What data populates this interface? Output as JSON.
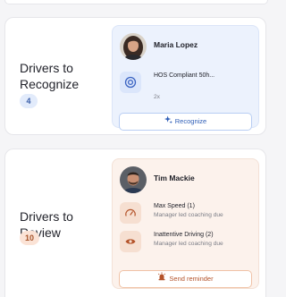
{
  "recognize": {
    "title": "Drivers to Recognize",
    "count": "4",
    "driver": {
      "name": "Maria Lopez"
    },
    "item": {
      "title": "HOS Compliant 50h...",
      "sub": "2x",
      "icon": "target-icon"
    },
    "button_label": "Recognize",
    "colors": {
      "accent": "#2f5eb7",
      "panel": "#ecf2fd"
    }
  },
  "review": {
    "title": "Drivers to Review",
    "count": "10",
    "driver": {
      "name": "Tim Mackie"
    },
    "items": [
      {
        "title": "Max Speed (1)",
        "sub": "Manager led coaching due",
        "icon": "speedometer-icon"
      },
      {
        "title": "Inattentive Driving (2)",
        "sub": "Manager led coaching due",
        "icon": "eye-icon"
      }
    ],
    "button_label": "Send reminder",
    "colors": {
      "accent": "#b4532a",
      "panel": "#fcf2ec"
    }
  }
}
